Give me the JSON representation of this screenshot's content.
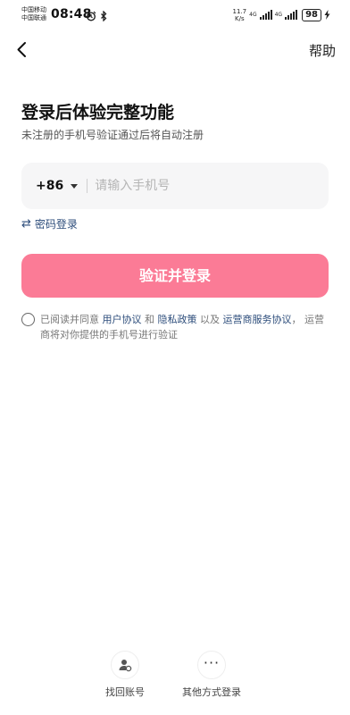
{
  "status_bar": {
    "carrier_1": "中国移动",
    "carrier_2": "中国联通",
    "time": "08:48",
    "net_speed_value": "11.7",
    "net_speed_unit": "K/s",
    "net_type_1": "4G",
    "net_type_2": "4G",
    "battery": "98"
  },
  "nav": {
    "help": "帮助"
  },
  "header": {
    "title": "登录后体验完整功能",
    "subtitle": "未注册的手机号验证通过后将自动注册"
  },
  "phone": {
    "country_code": "+86",
    "placeholder": "请输入手机号",
    "value": ""
  },
  "password_login": {
    "label": "密码登录"
  },
  "verify_button": {
    "label": "验证并登录"
  },
  "agreement": {
    "checked": false,
    "prefix": "已阅读并同意 ",
    "link_user": "用户协议",
    "and": " 和 ",
    "link_privacy": "隐私政策",
    "and2": " 以及 ",
    "link_carrier": "运营商服务协议",
    "suffix": "， 运营商将对你提供的手机号进行验证"
  },
  "bottom": {
    "recover": "找回账号",
    "other": "其他方式登录"
  },
  "colors": {
    "primary_button": "#fb7b96",
    "link": "#2d4d7b"
  }
}
